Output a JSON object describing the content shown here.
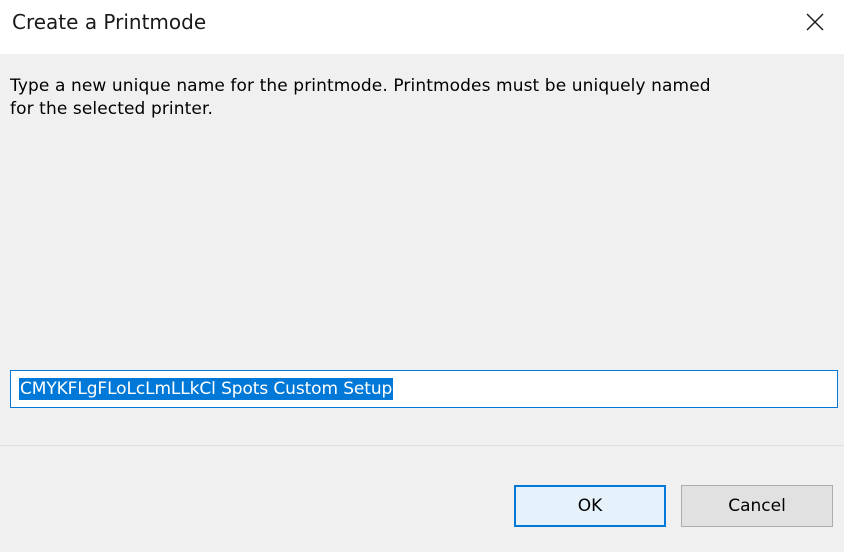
{
  "window": {
    "title": "Create a Printmode",
    "close_icon": "close-icon"
  },
  "dialog": {
    "prompt_line1": "Type a new unique name for the printmode. Printmodes must be uniquely named",
    "prompt_line2": "for the selected printer.",
    "name_value": "CMYKFLgFLoLcLmLLkCl Spots Custom Setup",
    "name_selected": true
  },
  "buttons": {
    "ok_label": "OK",
    "cancel_label": "Cancel"
  },
  "colors": {
    "accent": "#0078d7",
    "dialog_bg": "#f0f0f0",
    "ok_bg": "#e5f1fb",
    "cancel_bg": "#e1e1e1"
  }
}
